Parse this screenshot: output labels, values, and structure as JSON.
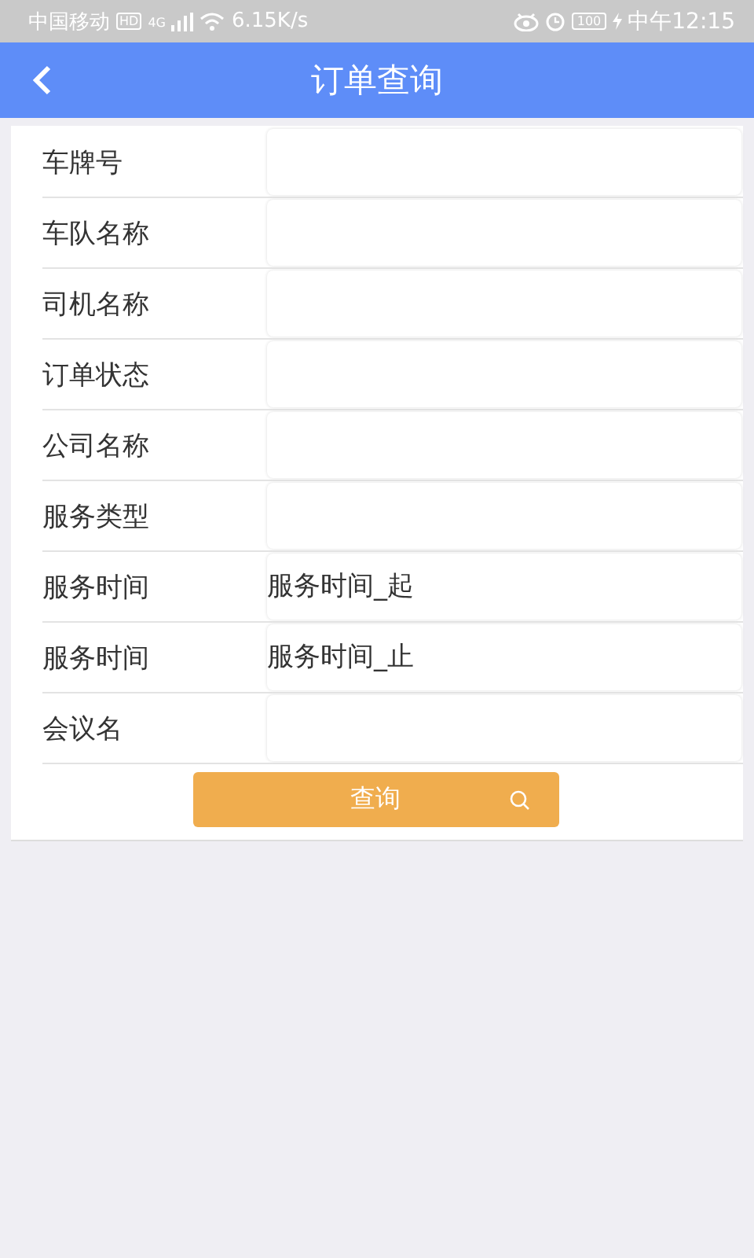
{
  "status_bar": {
    "carrier": "中国移动",
    "hd": "HD",
    "network": "4G",
    "speed": "6.15K/s",
    "battery": "100",
    "time": "中午12:15"
  },
  "header": {
    "title": "订单查询"
  },
  "fields": [
    {
      "label": "车牌号"
    },
    {
      "label": "车队名称"
    },
    {
      "label": "司机名称"
    },
    {
      "label": "订单状态"
    },
    {
      "label": "公司名称"
    },
    {
      "label": "服务类型"
    },
    {
      "label": "服务时间",
      "placeholder": "服务时间_起"
    },
    {
      "label": "服务时间",
      "placeholder": "服务时间_止"
    },
    {
      "label": "会议名"
    }
  ],
  "search_button": {
    "label": "查询"
  }
}
